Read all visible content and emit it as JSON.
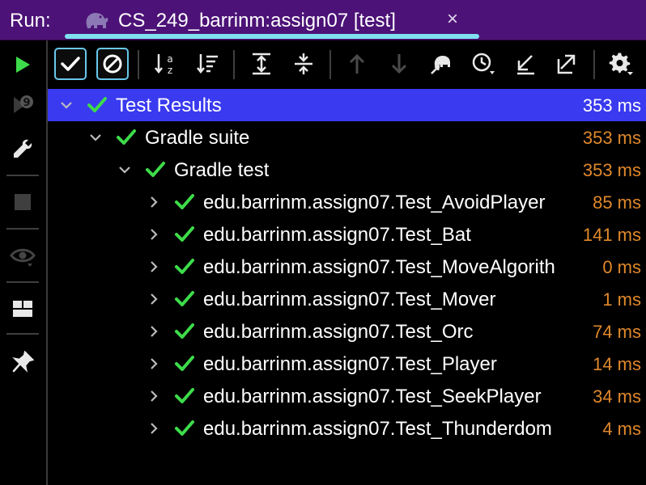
{
  "run_bar": {
    "label": "Run:",
    "tab_title": "CS_249_barrinm:assign07 [test]",
    "close_glyph": "×"
  },
  "colors": {
    "run_bar_bg": "#4c1277",
    "selected_row": "#3a3af0",
    "pass_green": "#3ddc4a",
    "duration_orange": "#e0882a",
    "tab_underline": "#7fe0f0"
  },
  "left_toolbar": {
    "items": [
      {
        "icon": "rerun-icon"
      },
      {
        "icon": "rerun-failed-icon"
      },
      {
        "icon": "wrench-icon"
      },
      {
        "icon": "stop-icon"
      },
      {
        "icon": "eye-icon"
      },
      {
        "icon": "layout-icon"
      },
      {
        "icon": "pin-icon"
      }
    ]
  },
  "toolbar": {
    "buttons": [
      {
        "icon": "show-passed-icon",
        "toggled": true
      },
      {
        "icon": "show-ignored-icon",
        "toggled": true
      },
      {
        "icon": "sort-alphabetically-icon",
        "toggled": false
      },
      {
        "icon": "sort-by-duration-icon",
        "toggled": false
      },
      {
        "icon": "expand-all-icon",
        "toggled": false
      },
      {
        "icon": "collapse-all-icon",
        "toggled": false
      },
      {
        "icon": "previous-test-icon",
        "toggled": false
      },
      {
        "icon": "next-test-icon",
        "toggled": false
      },
      {
        "icon": "gradle-elephant-icon",
        "toggled": false
      },
      {
        "icon": "history-icon",
        "toggled": false
      },
      {
        "icon": "import-icon",
        "toggled": false
      },
      {
        "icon": "export-icon",
        "toggled": false
      },
      {
        "icon": "settings-gear-icon",
        "toggled": false
      }
    ]
  },
  "tree": {
    "rows": [
      {
        "name": "Test Results",
        "time": "353 ms",
        "expanded": true,
        "selected": true
      },
      {
        "name": "Gradle suite",
        "time": "353 ms",
        "expanded": true,
        "selected": false
      },
      {
        "name": "Gradle test",
        "time": "353 ms",
        "expanded": true,
        "selected": false
      },
      {
        "name": "edu.barrinm.assign07.Test_AvoidPlayer",
        "time": "85 ms",
        "expanded": false,
        "selected": false
      },
      {
        "name": "edu.barrinm.assign07.Test_Bat",
        "time": "141 ms",
        "expanded": false,
        "selected": false
      },
      {
        "name": "edu.barrinm.assign07.Test_MoveAlgorith",
        "time": "0 ms",
        "expanded": false,
        "selected": false
      },
      {
        "name": "edu.barrinm.assign07.Test_Mover",
        "time": "1 ms",
        "expanded": false,
        "selected": false
      },
      {
        "name": "edu.barrinm.assign07.Test_Orc",
        "time": "74 ms",
        "expanded": false,
        "selected": false
      },
      {
        "name": "edu.barrinm.assign07.Test_Player",
        "time": "14 ms",
        "expanded": false,
        "selected": false
      },
      {
        "name": "edu.barrinm.assign07.Test_SeekPlayer",
        "time": "34 ms",
        "expanded": false,
        "selected": false
      },
      {
        "name": "edu.barrinm.assign07.Test_Thunderdom",
        "time": "4 ms",
        "expanded": false,
        "selected": false
      }
    ]
  }
}
